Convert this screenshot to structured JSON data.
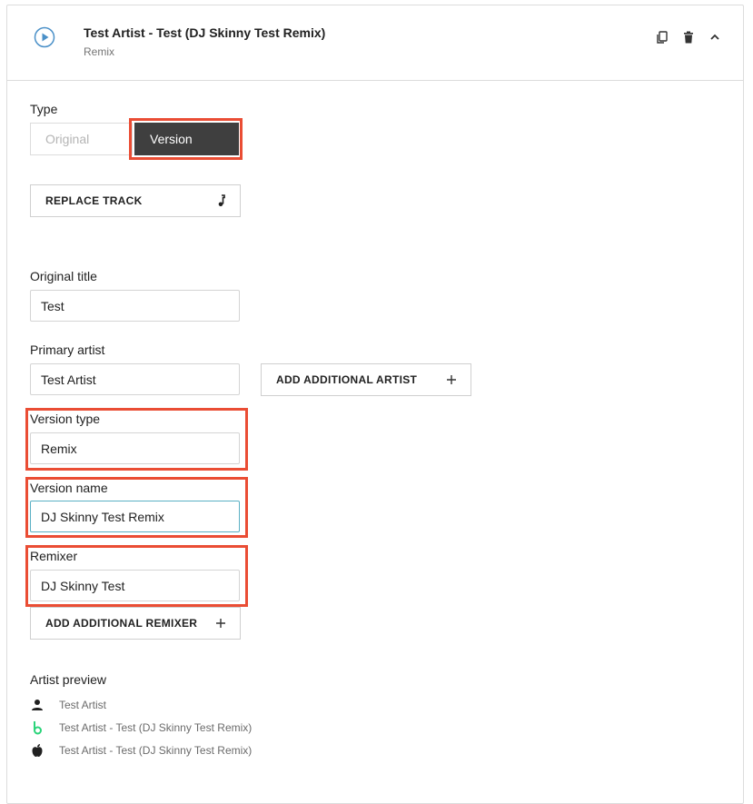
{
  "header": {
    "title": "Test Artist - Test (DJ Skinny Test Remix)",
    "subtitle": "Remix",
    "icons": [
      "play-icon",
      "copy-icon",
      "trash-icon",
      "chevron-up-icon"
    ]
  },
  "type": {
    "label": "Type",
    "options": [
      "Original",
      "Version"
    ],
    "selected": "Version"
  },
  "replace_track": {
    "label": "REPLACE TRACK",
    "icon": "music-note-icon"
  },
  "original_title": {
    "label": "Original title",
    "value": "Test"
  },
  "primary_artist": {
    "label": "Primary artist",
    "value": "Test Artist",
    "add_label": "ADD ADDITIONAL ARTIST"
  },
  "version_type": {
    "label": "Version type",
    "value": "Remix"
  },
  "version_name": {
    "label": "Version name",
    "value": "DJ Skinny Test Remix"
  },
  "remixer": {
    "label": "Remixer",
    "value": "DJ Skinny Test",
    "add_label": "ADD ADDITIONAL REMIXER"
  },
  "artist_preview": {
    "label": "Artist preview",
    "rows": [
      {
        "icon": "person-icon",
        "text": "Test Artist"
      },
      {
        "icon": "beatport-icon",
        "text": "Test Artist - Test (DJ Skinny Test Remix)"
      },
      {
        "icon": "apple-icon",
        "text": "Test Artist - Test (DJ Skinny Test Remix)"
      }
    ]
  },
  "colors": {
    "highlight": "#ea4d34",
    "selected_bg": "#3f3f3f",
    "beatport_green": "#2bd47a",
    "play_blue": "#4a90c8"
  }
}
